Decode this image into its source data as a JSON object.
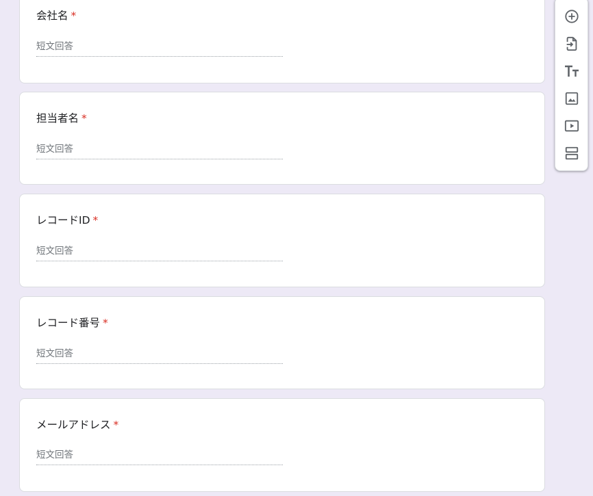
{
  "form": {
    "questions": [
      {
        "title": "会社名",
        "required_mark": "*",
        "placeholder": "短文回答"
      },
      {
        "title": "担当者名",
        "required_mark": "*",
        "placeholder": "短文回答"
      },
      {
        "title": "レコードID",
        "required_mark": "*",
        "placeholder": "短文回答"
      },
      {
        "title": "レコード番号",
        "required_mark": "*",
        "placeholder": "短文回答"
      },
      {
        "title": "メールアドレス",
        "required_mark": "*",
        "placeholder": "短文回答"
      }
    ]
  },
  "toolbar": {
    "items": [
      {
        "icon": "add-circle-icon"
      },
      {
        "icon": "import-questions-icon"
      },
      {
        "icon": "title-text-icon"
      },
      {
        "icon": "image-icon"
      },
      {
        "icon": "video-icon"
      },
      {
        "icon": "section-icon"
      }
    ]
  },
  "colors": {
    "background": "#ede9f6",
    "required": "#d93025",
    "icon": "#5f6368"
  }
}
